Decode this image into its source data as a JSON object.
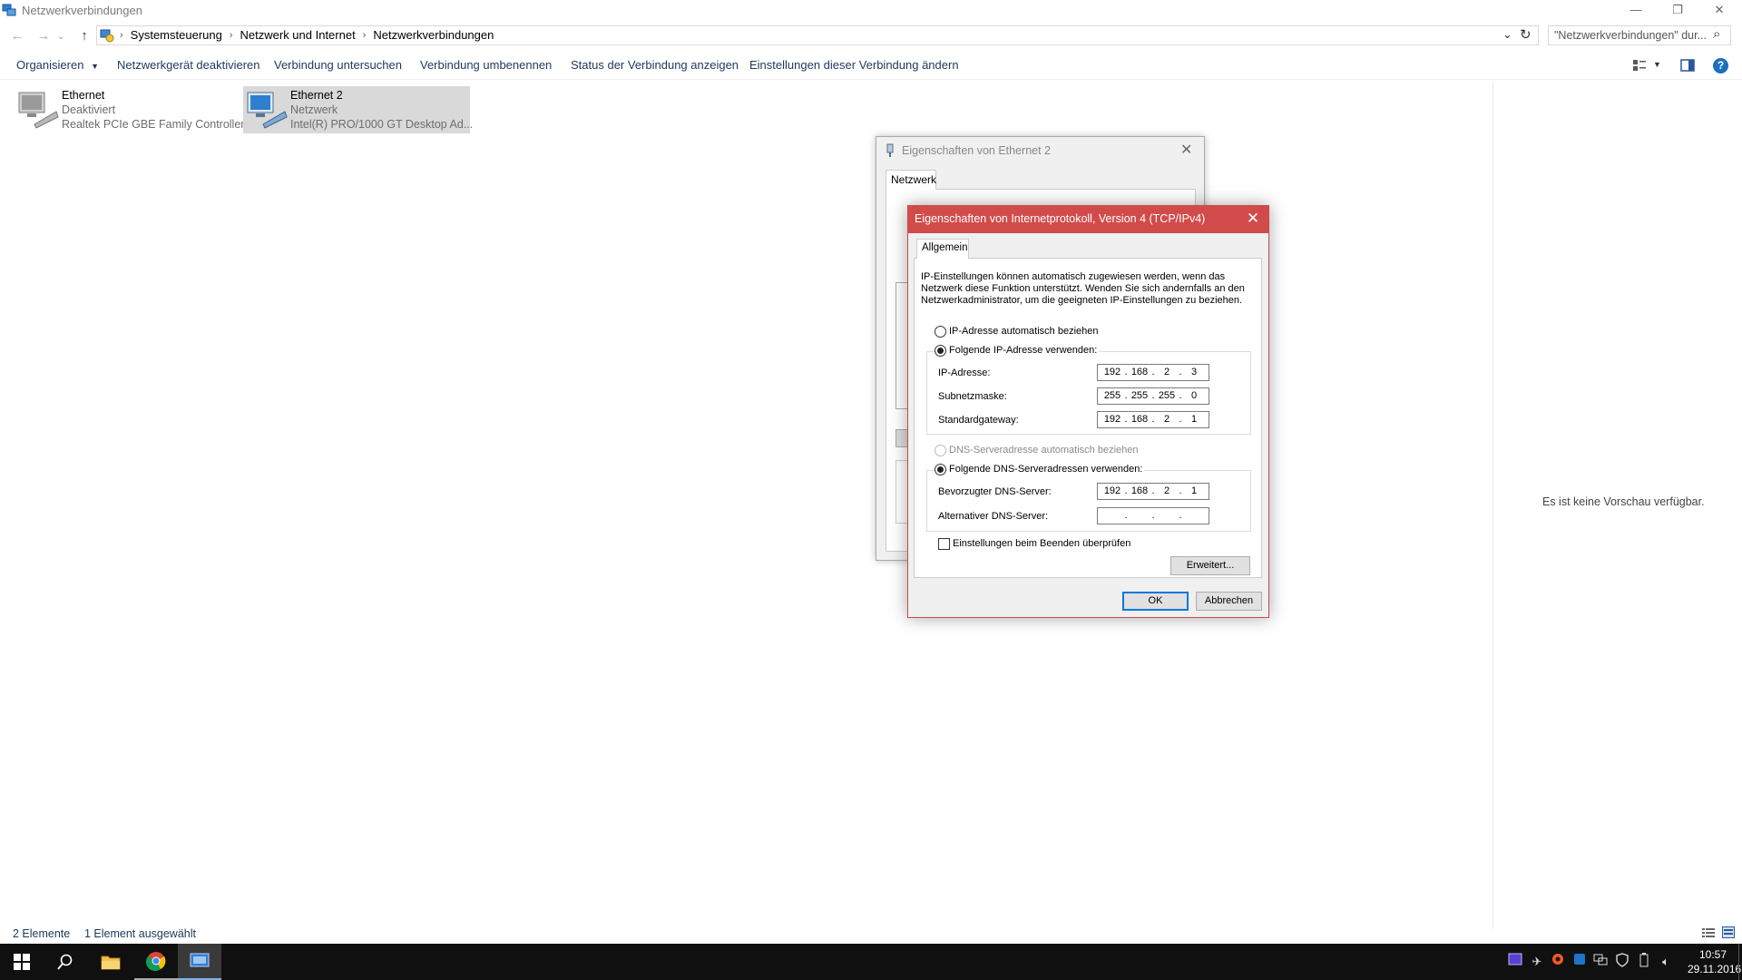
{
  "window": {
    "title": "Netzwerkverbindungen",
    "minimize": "—",
    "restore": "❐",
    "close": "✕"
  },
  "nav": {
    "back": "←",
    "forward": "→",
    "recent": "⌄",
    "up": "↑",
    "breadcrumb": [
      "Systemsteuerung",
      "Netzwerk und Internet",
      "Netzwerkverbindungen"
    ],
    "separator": "›",
    "dropdown": "⌄",
    "refresh": "↻",
    "search_placeholder": "\"Netzwerkverbindungen\" dur...",
    "search_icon": "⌕"
  },
  "commands": {
    "organize": "Organisieren",
    "disable": "Netzwerkgerät deaktivieren",
    "diagnose": "Verbindung untersuchen",
    "rename": "Verbindung umbenennen",
    "status": "Status der Verbindung anzeigen",
    "settings": "Einstellungen dieser Verbindung ändern",
    "help": "?"
  },
  "connections": [
    {
      "name": "Ethernet",
      "state": "Deaktiviert",
      "device": "Realtek PCIe GBE Family Controller"
    },
    {
      "name": "Ethernet 2",
      "state": "Netzwerk",
      "device": "Intel(R) PRO/1000 GT Desktop Ad..."
    }
  ],
  "preview": {
    "empty_text": "Es ist keine Vorschau verfügbar."
  },
  "status_bar": {
    "count": "2 Elemente",
    "selected": "1 Element ausgewählt"
  },
  "dialog_ethernet": {
    "title": "Eigenschaften von Ethernet 2",
    "tab": "Netzwerk",
    "close": "✕"
  },
  "dialog_ipv4": {
    "title": "Eigenschaften von Internetprotokoll, Version 4 (TCP/IPv4)",
    "close": "✕",
    "tab": "Allgemein",
    "description": "IP-Einstellungen können automatisch zugewiesen werden, wenn das Netzwerk diese Funktion unterstützt. Wenden Sie sich andernfalls an den Netzwerkadministrator, um die geeigneten IP-Einstellungen zu beziehen.",
    "ip_auto": "IP-Adresse automatisch beziehen",
    "ip_manual": "Folgende IP-Adresse verwenden:",
    "ip_address_label": "IP-Adresse:",
    "ip_address": [
      "192",
      "168",
      "2",
      "3"
    ],
    "subnet_label": "Subnetzmaske:",
    "subnet": [
      "255",
      "255",
      "255",
      "0"
    ],
    "gateway_label": "Standardgateway:",
    "gateway": [
      "192",
      "168",
      "2",
      "1"
    ],
    "dns_auto": "DNS-Serveradresse automatisch beziehen",
    "dns_manual": "Folgende DNS-Serveradressen verwenden:",
    "dns_preferred_label": "Bevorzugter DNS-Server:",
    "dns_preferred": [
      "192",
      "168",
      "2",
      "1"
    ],
    "dns_alternate_label": "Alternativer DNS-Server:",
    "dns_alternate": [
      "",
      "",
      "",
      ""
    ],
    "validate_label": "Einstellungen beim Beenden überprüfen",
    "advanced": "Erweitert...",
    "ok": "OK",
    "cancel": "Abbrechen"
  },
  "taskbar": {
    "clock_time": "10:57",
    "clock_date": "29.11.2016"
  }
}
